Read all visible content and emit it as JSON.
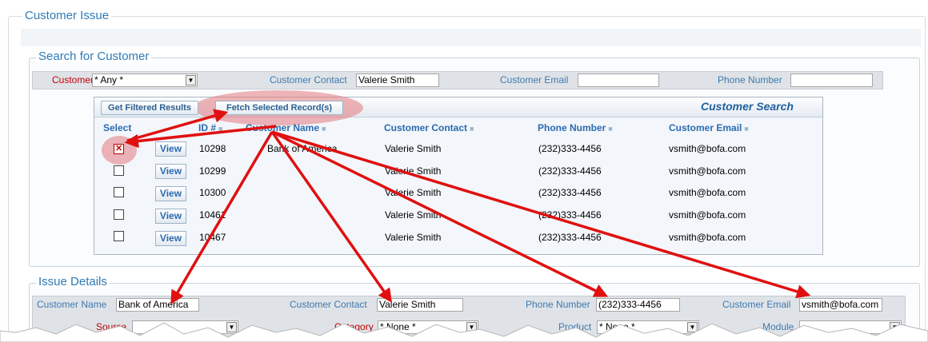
{
  "main_section": {
    "legend": "Customer Issue"
  },
  "search_section": {
    "legend": "Search for Customer",
    "customer_label": "Customer",
    "customer_select": "* Any *",
    "contact_label": "Customer Contact",
    "contact_value": "Valerie Smith",
    "email_label": "Customer Email",
    "email_value": "",
    "phone_label": "Phone Number",
    "phone_value": ""
  },
  "results_panel": {
    "get_filtered_label": "Get Filtered Results",
    "fetch_selected_label": "Fetch Selected Record(s)",
    "title": "Customer Search",
    "columns": {
      "select": "Select",
      "id": "ID #",
      "name": "Customer Name",
      "contact": "Customer Contact",
      "phone": "Phone Number",
      "email": "Customer Email"
    },
    "view_label": "View",
    "rows": [
      {
        "checked": true,
        "id": "10298",
        "name": "Bank of America",
        "contact": "Valerie Smith",
        "phone": "(232)333-4456",
        "email": "vsmith@bofa.com"
      },
      {
        "checked": false,
        "id": "10299",
        "name": "",
        "contact": "Valerie Smith",
        "phone": "(232)333-4456",
        "email": "vsmith@bofa.com"
      },
      {
        "checked": false,
        "id": "10300",
        "name": "",
        "contact": "Valerie Smith",
        "phone": "(232)333-4456",
        "email": "vsmith@bofa.com"
      },
      {
        "checked": false,
        "id": "10461",
        "name": "",
        "contact": "Valerie Smith",
        "phone": "(232)333-4456",
        "email": "vsmith@bofa.com"
      },
      {
        "checked": false,
        "id": "10467",
        "name": "",
        "contact": "Valerie Smith",
        "phone": "(232)333-4456",
        "email": "vsmith@bofa.com"
      }
    ]
  },
  "issue_section": {
    "legend": "Issue Details",
    "name_label": "Customer Name",
    "name_value": "Bank of America",
    "contact_label": "Customer Contact",
    "contact_value": "Valerie Smith",
    "phone_label": "Phone Number",
    "phone_value": "(232)333-4456",
    "email_label": "Customer Email",
    "email_value": "vsmith@bofa.com",
    "source_label": "Source",
    "category_label": "Category",
    "category_value": "* None *",
    "product_label": "Product",
    "product_value": "* None *",
    "module_label": "Module"
  },
  "colors": {
    "accent": "#2f7bb6",
    "arrow": "#e01010",
    "highlight": "#e2878a"
  }
}
